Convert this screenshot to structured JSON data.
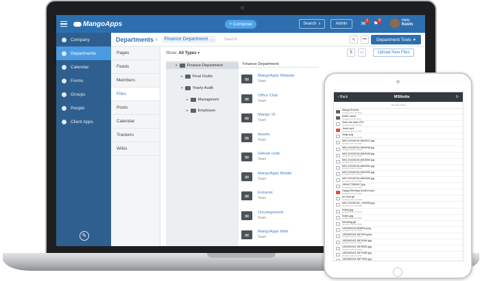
{
  "topbar": {
    "app_name": "MangoApps",
    "compose_label": "+ Compose",
    "search_label": "Search",
    "admin_label": "Admin",
    "greeting": "Hello",
    "user_name": "Kevin",
    "message_badge": "1",
    "notification_badge": "9"
  },
  "sidebar": {
    "items": [
      {
        "label": "Company"
      },
      {
        "label": "Departments"
      },
      {
        "label": "Calendar"
      },
      {
        "label": "Forms"
      },
      {
        "label": "Groups"
      },
      {
        "label": "People"
      },
      {
        "label": "Client Apps"
      }
    ]
  },
  "header": {
    "crumb_root": "Departments",
    "crumb_current": "Finance Department ...",
    "search_placeholder": "Search",
    "more_label": "•••",
    "tools_label": "Department Tools"
  },
  "subnav": {
    "items": [
      {
        "label": "Pages"
      },
      {
        "label": "Feeds"
      },
      {
        "label": "Members"
      },
      {
        "label": "Files"
      },
      {
        "label": "Posts"
      },
      {
        "label": "Calendar"
      },
      {
        "label": "Trackers"
      },
      {
        "label": "Wikis"
      }
    ]
  },
  "files": {
    "show_label": "Show:",
    "show_value": "All Types",
    "upload_label": "Upload New Files",
    "list_header": "Finance Department",
    "tree": [
      {
        "label": "Finance Department"
      },
      {
        "label": "Final Drafts"
      },
      {
        "label": "Yearly Audit"
      },
      {
        "label": "Managment"
      },
      {
        "label": "Employee"
      }
    ],
    "rows": [
      {
        "name": "MangoApps Website",
        "sub": "Team"
      },
      {
        "name": "Office Chat",
        "sub": "Team"
      },
      {
        "name": "Mango 15",
        "sub": "Team"
      },
      {
        "name": "Assets",
        "sub": "Team"
      },
      {
        "name": "GitHub code",
        "sub": "Team"
      },
      {
        "name": "MangoApps Mobile",
        "sub": "Team"
      },
      {
        "name": "Extranet",
        "sub": "Team"
      },
      {
        "name": "Uncategorized",
        "sub": "Team"
      },
      {
        "name": "MangoApps Web",
        "sub": "Team"
      }
    ]
  },
  "ipad": {
    "back_label": "‹ Back",
    "title": "MSIIndia",
    "sort_label": "Sort First",
    "rows": [
      {
        "name": "Mango Events",
        "date": "Updated Dec 20 2014",
        "icon": "folder"
      },
      {
        "name": "folder name",
        "date": "Updated Jul 02 2014",
        "icon": "folder"
      },
      {
        "name": "Save the date.JPG",
        "date": "Updated Feb 08 2015",
        "icon": "doc"
      },
      {
        "name": "Yoski.mp4",
        "date": "Updated Jan 12 2015",
        "icon": "red"
      },
      {
        "name": "Ninja.png",
        "date": "Updated Feb 11 2015",
        "icon": "doc"
      },
      {
        "name": "IMG-20160216-WA0047.jpg",
        "date": "Updated Feb 19 2016",
        "icon": "doc"
      },
      {
        "name": "IMG-20160216-WA0048.jpg",
        "date": "Updated Feb 19 2016",
        "icon": "doc"
      },
      {
        "name": "IMG-20160216-WA0049.jpg",
        "date": "Updated Feb 19 2016",
        "icon": "doc"
      },
      {
        "name": "IMG-20160216-WA0050.jpg",
        "date": "Updated Feb 19 2016",
        "icon": "doc"
      },
      {
        "name": "IMG-20160216-WA0051.jpg",
        "date": "Updated Feb 19 2016",
        "icon": "doc"
      },
      {
        "name": "IMG-20160216-WA0052.jpg",
        "date": "Updated Feb 19 2016",
        "icon": "doc"
      },
      {
        "name": "IMG-20160216-WA0053.jpg",
        "date": "Updated Feb 19 2016",
        "icon": "doc"
      },
      {
        "name": "1454477853947.jpg",
        "date": "Updated Feb 03 2016",
        "icon": "doc"
      },
      {
        "name": "Happy Birthday Anakhi.mp4",
        "date": "Updated Feb 03 2016",
        "icon": "red"
      },
      {
        "name": "pic new.gif",
        "date": "Updated Feb 03 2016",
        "icon": "doc"
      },
      {
        "name": "IMG-20160218-_000098.jpg",
        "date": "Updated Feb 18 2016",
        "icon": "doc"
      },
      {
        "name": "Nokia.jpg",
        "date": "Updated Feb 03 2016",
        "icon": "doc"
      },
      {
        "name": "Notes.jpg",
        "date": "Updated Feb 03 2016",
        "icon": "doc"
      },
      {
        "name": "Wedding.gif",
        "date": "Updated Feb 03 2016",
        "icon": "doc"
      },
      {
        "name": "1453450411263564.jpeg",
        "date": "Updated Feb 01 2016",
        "icon": "doc"
      },
      {
        "name": "1453450411.587464.jpeg",
        "date": "Updated Feb 01 2016",
        "icon": "doc"
      },
      {
        "name": "1453450411.5874064.jpg",
        "date": "Updated Feb 01 2016",
        "icon": "doc"
      },
      {
        "name": "1453450411.5875563.jpg",
        "date": "Updated Feb 01 2016",
        "icon": "doc"
      },
      {
        "name": "1453450411.5877685.jpg",
        "date": "Updated Feb 01 2016",
        "icon": "doc"
      },
      {
        "name": "1453450411.5877805.jpg",
        "date": "Updated Feb 01 2016",
        "icon": "doc"
      }
    ]
  }
}
